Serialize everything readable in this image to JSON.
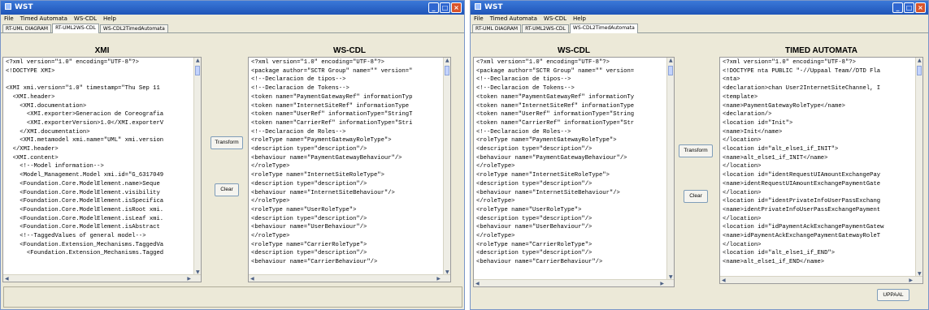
{
  "windows": [
    {
      "title": "WST",
      "menu": [
        "File",
        "Timed Automata",
        "WS-CDL",
        "Help"
      ],
      "tabs": [
        {
          "label": "RT-UML DIAGRAM",
          "active": false
        },
        {
          "label": "RT-UML2WS-CDL",
          "active": true
        },
        {
          "label": "WS-CDL2TimedAutomata",
          "active": false
        }
      ],
      "left_panel": {
        "title": "XMI",
        "lines": [
          "<?xml version=\"1.0\" encoding=\"UTF-8\"?>",
          "<!DOCTYPE XMI>",
          "",
          "<XMI xmi.version=\"1.0\" timestamp=\"Thu Sep 11",
          "  <XMI.header>",
          "    <XMI.documentation>",
          "      <XMI.exporter>Generacion de Coreografia",
          "      <XMI.exporterVersion>1.0</XMI.exporterV",
          "    </XMI.documentation>",
          "    <XMI.metamodel xmi.name=\"UML\" xmi.version",
          "  </XMI.header>",
          "  <XMI.content>",
          "    <!--Model information-->",
          "    <Model_Management.Model xmi.id=\"G_6317049",
          "    <Foundation.Core.ModelElement.name>Seque",
          "    <Foundation.Core.ModelElement.visibility",
          "    <Foundation.Core.ModelElement.isSpecifica",
          "    <Foundation.Core.ModelElement.isRoot xmi.",
          "    <Foundation.Core.ModelElement.isLeaf xmi.",
          "    <Foundation.Core.ModelElement.isAbstract",
          "    <!--TaggedValues of general model-->",
          "    <Foundation.Extension_Mechanisms.TaggedVa",
          "      <Foundation.Extension_Mechanisms.Tagged"
        ]
      },
      "buttons": [
        "Transform",
        "Clear"
      ],
      "right_panel": {
        "title": "WS-CDL",
        "lines": [
          "<?xml version=\"1.0\" encoding=\"UTF-8\"?>",
          "<package author=\"SCTR Group\" name=\"\" version=\"",
          "<!--Declaracion de tipos-->",
          "<!--Declaracion de Tokens-->",
          "<token name=\"PaymentGatewayRef\" informationTyp",
          "<token name=\"InternetSiteRef\" informationType",
          "<token name=\"UserRef\" informationType=\"StringT",
          "<token name=\"CarrierRef\" informationType=\"Stri",
          "<!--Declaracion de Roles-->",
          "<roleType name=\"PaymentGatewayRoleType\">",
          "<description type=\"description\"/>",
          "<behaviour name=\"PaymentGatewayBehaviour\"/>",
          "</roleType>",
          "<roleType name=\"InternetSiteRoleType\">",
          "<description type=\"description\"/>",
          "<behaviour name=\"InternetSiteBehaviour\"/>",
          "</roleType>",
          "<roleType name=\"UserRoleType\">",
          "<description type=\"description\"/>",
          "<behaviour name=\"UserBehaviour\"/>",
          "</roleType>",
          "<roleType name=\"CarrierRoleType\">",
          "<description type=\"description\"/>",
          "<behaviour name=\"CarrierBehaviour\"/>"
        ]
      }
    },
    {
      "title": "WST",
      "menu": [
        "File",
        "Timed Automata",
        "WS-CDL",
        "Help"
      ],
      "tabs": [
        {
          "label": "RT-UML DIAGRAM",
          "active": false
        },
        {
          "label": "RT-UML2WS-CDL",
          "active": false
        },
        {
          "label": "WS-CDL2TimedAutomata",
          "active": true
        }
      ],
      "left_panel": {
        "title": "WS-CDL",
        "lines": [
          "<?xml version=\"1.0\" encoding=\"UTF-8\"?>",
          "<package author=\"SCTR Group\" name=\"\" version=",
          "<!--Declaracion de tipos-->",
          "<!--Declaracion de Tokens-->",
          "<token name=\"PaymentGatewayRef\" informationTy",
          "<token name=\"InternetSiteRef\" informationType",
          "<token name=\"UserRef\" informationType=\"String",
          "<token name=\"CarrierRef\" informationType=\"Str",
          "<!--Declaracion de Roles-->",
          "<roleType name=\"PaymentGatewayRoleType\">",
          "<description type=\"description\"/>",
          "<behaviour name=\"PaymentGatewayBehaviour\"/>",
          "</roleType>",
          "<roleType name=\"InternetSiteRoleType\">",
          "<description type=\"description\"/>",
          "<behaviour name=\"InternetSiteBehaviour\"/>",
          "</roleType>",
          "<roleType name=\"UserRoleType\">",
          "<description type=\"description\"/>",
          "<behaviour name=\"UserBehaviour\"/>",
          "</roleType>",
          "<roleType name=\"CarrierRoleType\">",
          "<description type=\"description\"/>",
          "<behaviour name=\"CarrierBehaviour\"/>"
        ]
      },
      "buttons": [
        "Transform",
        "Clear"
      ],
      "right_panel": {
        "title": "TIMED AUTOMATA",
        "lines": [
          "<?xml version=\"1.0\" encoding=\"UTF-8\"?>",
          "<!DOCTYPE nta PUBLIC \"-//Uppaal Team//DTD Fla",
          "<nta>",
          "<declaration>chan User2InternetSiteChannel, I",
          "<template>",
          "<name>PaymentGatewayRoleType</name>",
          "<declaration/>",
          "<location id=\"Init\">",
          "<name>Init</name>",
          "</location>",
          "<location id=\"alt_else1_if_INIT\">",
          "<name>alt_else1_if_INIT</name>",
          "</location>",
          "<location id=\"identRequestUIAmountExchangePay",
          "<name>identRequestUIAmountExchangePaymentGate",
          "</location>",
          "<location id=\"identPrivateInfoUserPassExchang",
          "<name>identPrivateInfoUserPassExchangePayment",
          "</location>",
          "<location id=\"idPaymentAckExchangePaymentGatew",
          "<name>idPaymentAckExchangePaymentGatewayRoleT",
          "</location>",
          "<location id=\"alt_else1_if_END\">",
          "<name>alt_else1_if_END</name>"
        ]
      },
      "extra_button": "UPPAAL"
    }
  ]
}
